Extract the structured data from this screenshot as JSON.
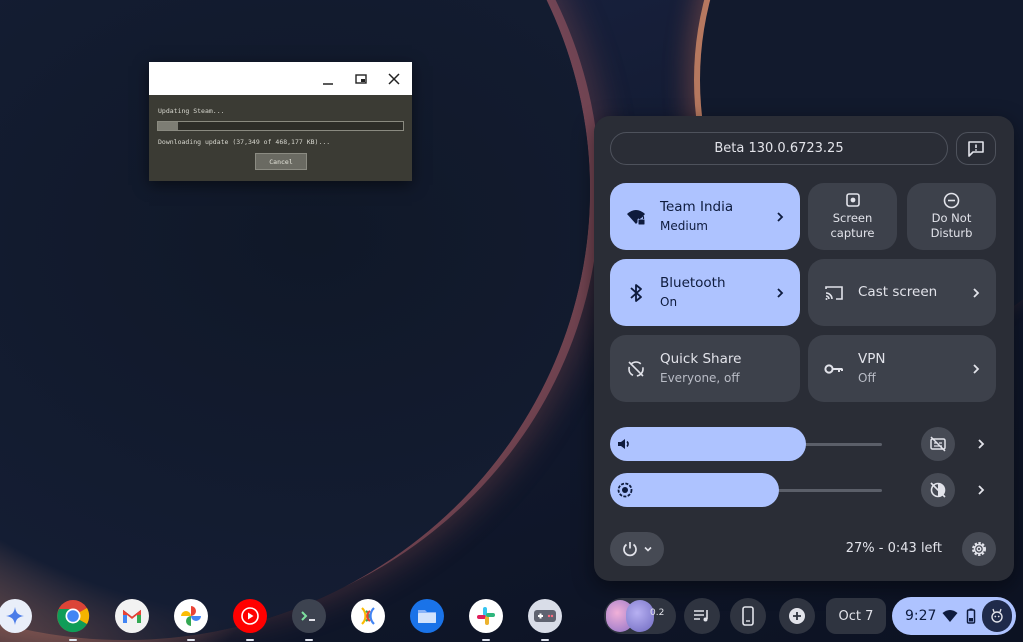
{
  "steam_window": {
    "status": "Updating Steam...",
    "detail": "Downloading update (37,349 of 468,177 KB)...",
    "progress": 0.08,
    "cancel_label": "Cancel",
    "minimize_icon": "minimize-icon",
    "restore_icon": "restore-icon",
    "close_icon": "close-icon"
  },
  "quick_settings": {
    "version": "Beta 130.0.6723.25",
    "feedback_icon": "feedback-icon",
    "tiles": {
      "wifi": {
        "title": "Team India",
        "subtitle": "Medium",
        "state": "on",
        "icon": "wifi-lock-icon"
      },
      "screen_capture": {
        "line1": "Screen",
        "line2": "capture",
        "icon": "screen-capture-icon"
      },
      "dnd": {
        "line1": "Do Not",
        "line2": "Disturb",
        "icon": "do-not-disturb-icon"
      },
      "bluetooth": {
        "title": "Bluetooth",
        "subtitle": "On",
        "state": "on",
        "icon": "bluetooth-icon"
      },
      "cast": {
        "title": "Cast screen",
        "icon": "cast-icon"
      },
      "quick_share": {
        "title": "Quick Share",
        "subtitle": "Everyone, off",
        "state": "off",
        "icon": "quick-share-icon"
      },
      "vpn": {
        "title": "VPN",
        "subtitle": "Off",
        "state": "off",
        "icon": "vpn-key-icon"
      }
    },
    "volume": {
      "level": 0.72,
      "icon": "volume-icon",
      "side_icon": "captions-off-icon"
    },
    "brightness": {
      "level": 0.62,
      "icon": "brightness-icon",
      "side_icon": "night-light-off-icon"
    },
    "battery_text": "27% - 0:43 left",
    "power_icon": "power-icon",
    "settings_icon": "settings-gear-icon"
  },
  "shelf": {
    "apps": [
      "gemini",
      "chrome",
      "gmail",
      "photos",
      "youtube-music",
      "terminal",
      "kdeconnect",
      "files",
      "slack",
      "steam-games"
    ],
    "pod_badge": "0.2",
    "date": "Oct 7",
    "time": "9:27",
    "accent": "#aec3ff"
  }
}
